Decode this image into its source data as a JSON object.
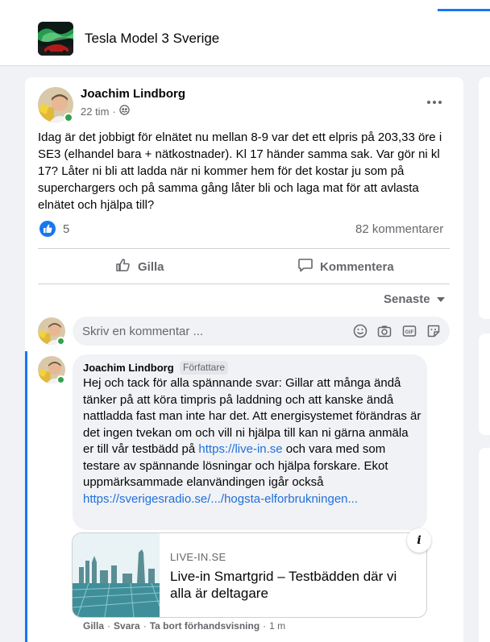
{
  "group": {
    "name": "Tesla Model 3 Sverige"
  },
  "post": {
    "author": "Joachim Lindborg",
    "time": "22 tim",
    "separator": "·",
    "text": "Idag är det jobbigt för elnätet nu mellan 8-9 var det ett elpris på 203,33 öre i SE3 (elhandel bara + nätkostnader). Kl 17 händer samma sak. Var gör ni kl 17? Låter ni bli att ladda när ni kommer hem för det kostar ju som på superchargers och på samma gång låter bli och laga mat för att avlasta elnätet och hjälpa till?",
    "reaction_count": "5",
    "comment_count": "82 kommentarer",
    "like_label": "Gilla",
    "comment_label": "Kommentera"
  },
  "comments": {
    "sort_label": "Senaste",
    "composer_placeholder": "Skriv en kommentar ...",
    "composer_icons": [
      "smiley-icon",
      "camera-icon",
      "gif-icon",
      "sticker-icon"
    ],
    "items": [
      {
        "author": "Joachim Lindborg",
        "badge": "Författare",
        "text_1": "Hej och tack för alla spännande svar: Gillar att många ändå tänker på att köra timpris på laddning och att kanske ändå nattladda fast man inte har det. Att energisystemet förändras är det ingen tvekan om och vill ni hjälpa till kan ni gärna anmäla er till vår testbädd på ",
        "link_1": "https://live-in.se",
        "text_2": " och vara med som testare av spännande lösningar och hjälpa forskare. Ekot uppmärksammade elanvändingen igår också ",
        "link_2": "https://sverigesradio.se/.../hogsta-elforbrukningen...",
        "preview": {
          "domain": "LIVE-IN.SE",
          "title": "Live-in Smartgrid – Testbädden där vi alla är deltagare",
          "info_label": "i"
        },
        "actions": {
          "like": "Gilla",
          "reply": "Svara",
          "remove_preview": "Ta bort förhandsvisning",
          "time": "1 m",
          "separator": "·"
        }
      }
    ]
  },
  "colors": {
    "accent": "#1877f2",
    "link": "#216fdb",
    "secondary_text": "#65676b",
    "online": "#31a24c"
  }
}
